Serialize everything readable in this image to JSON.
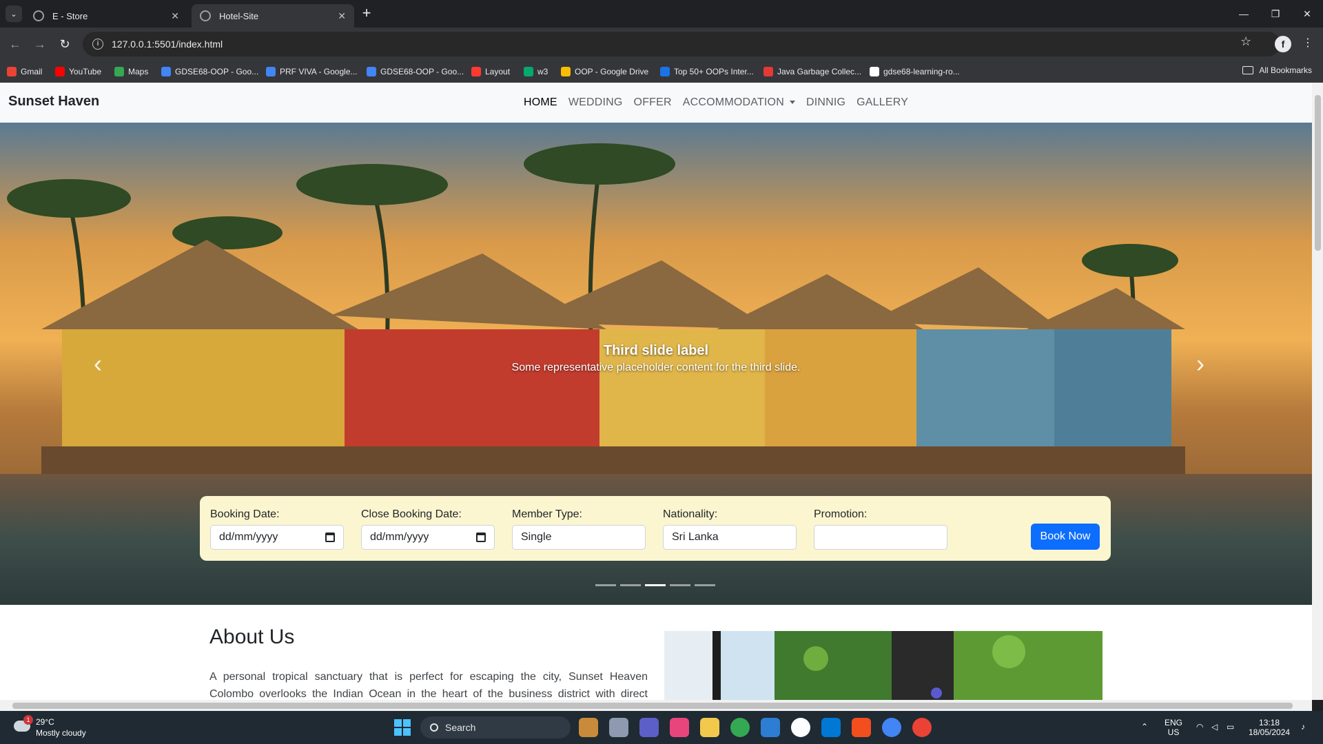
{
  "browser": {
    "tabs": [
      {
        "title": "E - Store",
        "active": false
      },
      {
        "title": "Hotel-Site",
        "active": true
      }
    ],
    "url": "127.0.0.1:5501/index.html",
    "bookmarks": [
      {
        "label": "Gmail",
        "color": "#ea4335"
      },
      {
        "label": "YouTube",
        "color": "#ff0000"
      },
      {
        "label": "Maps",
        "color": "#34a853"
      },
      {
        "label": "GDSE68-OOP - Goo...",
        "color": "#4285f4"
      },
      {
        "label": "PRF VIVA - Google...",
        "color": "#4285f4"
      },
      {
        "label": "GDSE68-OOP - Goo...",
        "color": "#4285f4"
      },
      {
        "label": "Layout",
        "color": "#ff3b30"
      },
      {
        "label": "w3",
        "color": "#04aa6d"
      },
      {
        "label": "OOP - Google Drive",
        "color": "#fbbc04"
      },
      {
        "label": "Top 50+ OOPs Inter...",
        "color": "#1a73e8"
      },
      {
        "label": "Java Garbage Collec...",
        "color": "#e53935"
      },
      {
        "label": "gdse68-learning-ro...",
        "color": "#ffffff"
      }
    ],
    "all_bookmarks": "All Bookmarks"
  },
  "site": {
    "brand": "Sunset Haven",
    "nav": [
      {
        "label": "HOME",
        "active": true
      },
      {
        "label": "WEDDING"
      },
      {
        "label": "OFFER"
      },
      {
        "label": "ACCOMMODATION",
        "dropdown": true
      },
      {
        "label": "DINNIG"
      },
      {
        "label": "GALLERY"
      }
    ],
    "carousel": {
      "caption_title": "Third slide label",
      "caption_text": "Some representative placeholder content for the third slide.",
      "indicator_count": 5,
      "active_index": 2
    },
    "booking": {
      "booking_date_label": "Booking Date:",
      "booking_date_value": "dd/mm/yyyy",
      "close_date_label": "Close Booking Date:",
      "close_date_value": "dd/mm/yyyy",
      "member_type_label": "Member Type:",
      "member_type_value": "Single",
      "nationality_label": "Nationality:",
      "nationality_value": "Sri Lanka",
      "promotion_label": "Promotion:",
      "promotion_value": "",
      "book_button": "Book Now",
      "button_color": "#0d6efd"
    },
    "about": {
      "title": "About Us",
      "text": "A personal tropical sanctuary that is perfect for escaping the city, Sunset Heaven Colombo overlooks the Indian Ocean in the heart of the business district with direct access to the"
    }
  },
  "taskbar": {
    "weather_temp": "29°C",
    "weather_desc": "Mostly cloudy",
    "weather_badge": "1",
    "search_label": "Search",
    "lang_top": "ENG",
    "lang_bottom": "US",
    "time": "13:18",
    "date": "18/05/2024"
  }
}
